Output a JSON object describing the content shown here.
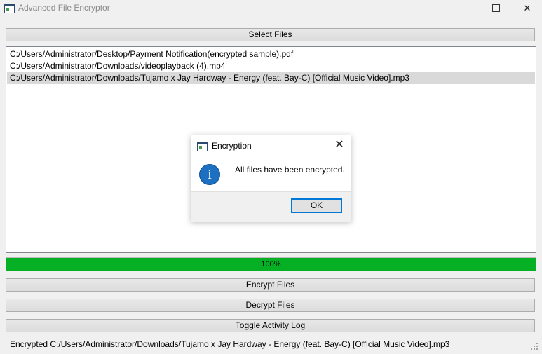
{
  "window": {
    "title": "Advanced File Encryptor",
    "controls": {
      "minimize": "minimize",
      "maximize": "maximize",
      "close": "✕"
    }
  },
  "toolbar": {
    "select_files_label": "Select Files"
  },
  "file_list": {
    "items": [
      "C:/Users/Administrator/Desktop/Payment Notification(encrypted sample).pdf",
      "C:/Users/Administrator/Downloads/videoplayback (4).mp4",
      "C:/Users/Administrator/Downloads/Tujamo x Jay Hardway - Energy (feat. Bay-C) [Official Music Video].mp3"
    ],
    "selected_index": 2
  },
  "progress": {
    "value": 1.0,
    "label": "100%",
    "color": "#06b025"
  },
  "actions": {
    "encrypt_label": "Encrypt Files",
    "decrypt_label": "Decrypt Files",
    "toggle_log_label": "Toggle Activity Log"
  },
  "status_bar": {
    "text": "Encrypted C:/Users/Administrator/Downloads/Tujamo x Jay Hardway - Energy (feat. Bay-C) [Official Music Video].mp3"
  },
  "dialog": {
    "title": "Encryption",
    "close_glyph": "✕",
    "icon": "info-icon",
    "icon_glyph": "i",
    "message": "All files have been encrypted.",
    "ok_label": "OK",
    "accent_color": "#0078d7"
  }
}
